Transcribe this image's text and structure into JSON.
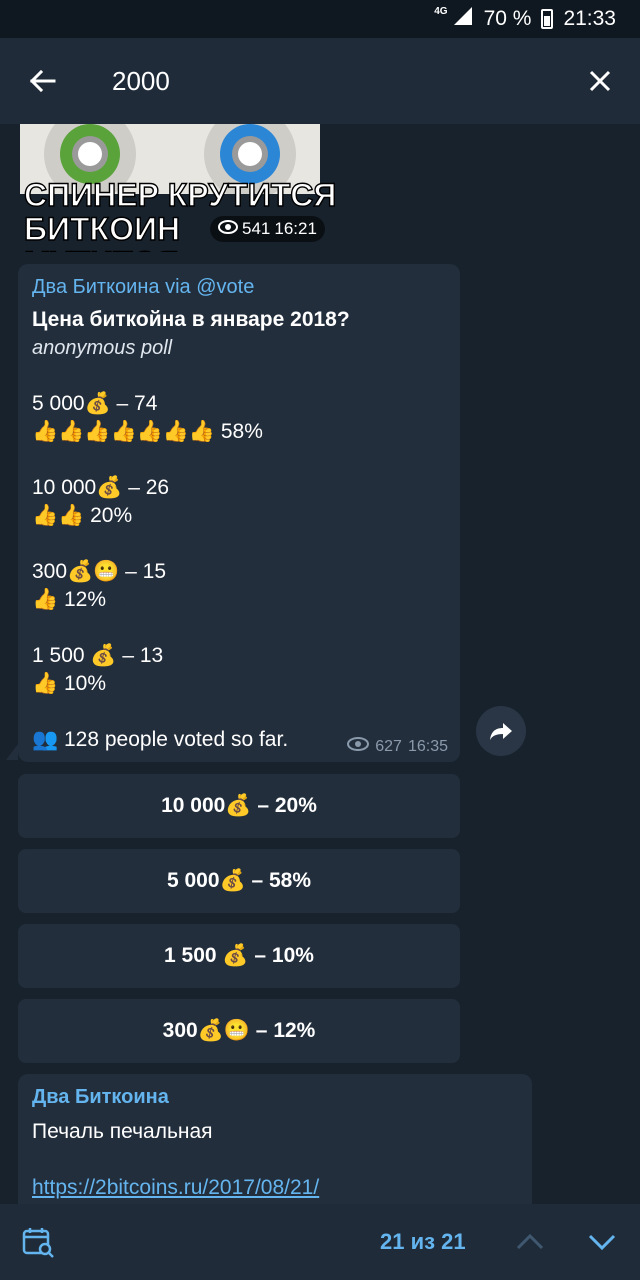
{
  "status": {
    "network": "4G",
    "battery": "70 %",
    "time": "21:33"
  },
  "search": {
    "value": "2000"
  },
  "sticker": {
    "text": "СПИНЕР КРУТИТСЯ\nБИТКОИН МУТИТСЯ",
    "views": "541",
    "time": "16:21"
  },
  "post": {
    "author": "Два Биткоина",
    "via": "via @vote",
    "question": "Цена биткойна в январе 2018?",
    "type": "anonymous poll",
    "options": [
      {
        "label": "5 000💰 – 74",
        "bar": "👍👍👍👍👍👍👍 58%"
      },
      {
        "label": "10 000💰 – 26",
        "bar": "👍👍 20%"
      },
      {
        "label": "300💰😬 – 15",
        "bar": "👍 12%"
      },
      {
        "label": "1 500 💰 – 13",
        "bar": "👍 10%"
      }
    ],
    "voters": "👥 128 people voted so far.",
    "views": "627",
    "time": "16:35"
  },
  "vote_buttons": [
    "10 000💰 – 20%",
    "5 000💰 – 58%",
    "1 500 💰 – 10%",
    "300💰😬 – 12%"
  ],
  "next_post": {
    "author": "Два Биткоина",
    "text": "Печаль печальная",
    "link": "https://2bitcoins.ru/2017/08/21/"
  },
  "bottom": {
    "counter": "21 из 21"
  },
  "colors": {
    "bg": "#18222d",
    "bubble": "#232e3c",
    "accent": "#64b5ef",
    "bar": "#1f2b38"
  }
}
